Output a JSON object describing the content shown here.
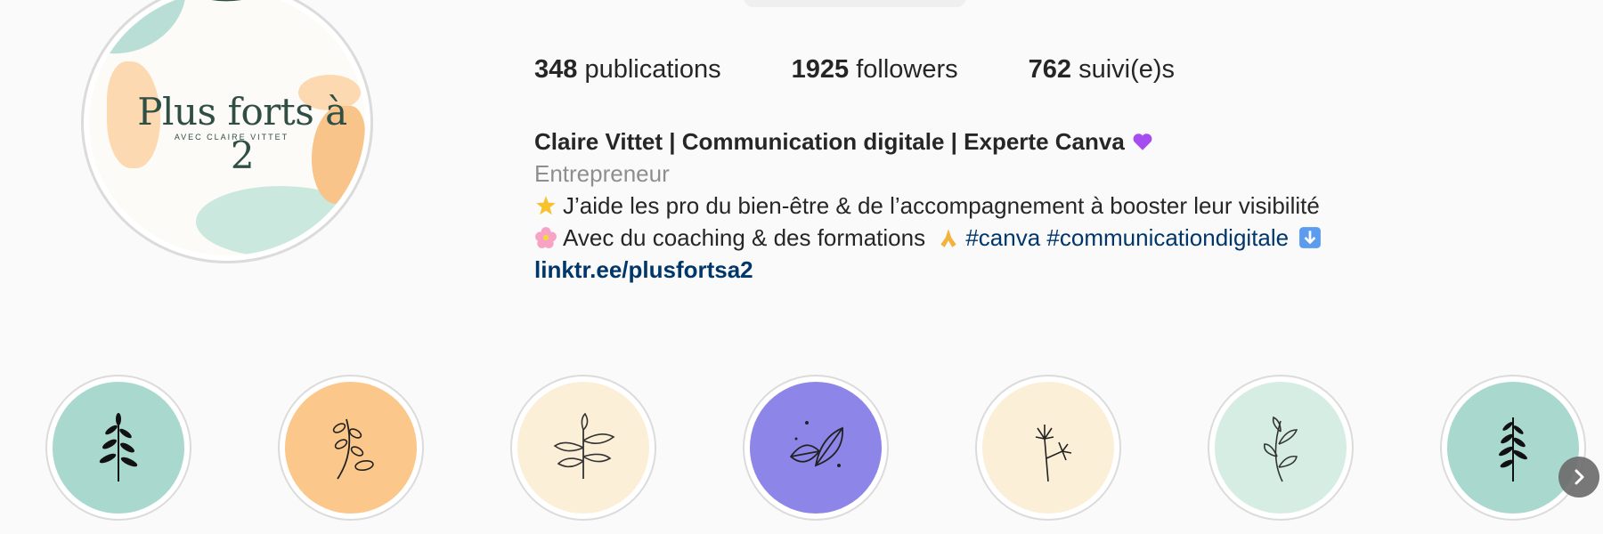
{
  "profile": {
    "avatar": {
      "logo_title": "Plus forts à 2",
      "logo_subtitle": "AVEC CLAIRE VITTET"
    },
    "stats": {
      "posts_count": "348",
      "posts_label": "publications",
      "followers_count": "1925",
      "followers_label": "followers",
      "following_count": "762",
      "following_label": "suivi(e)s"
    },
    "bio": {
      "name": "Claire Vittet | Communication digitale | Experte Canva",
      "name_emoji": "purple-heart-icon",
      "category": "Entrepreneur",
      "line1_text": "J’aide les pro du bien-être & de l’accompagnement à booster leur visibilité",
      "line1_emoji": "glowing-star-icon",
      "line2_text": "Avec du coaching & des formations",
      "line2_emoji_start": "cherry-blossom-icon",
      "line2_emoji_end": "folded-hands-icon",
      "hashtag1": "#canva",
      "hashtag2": "#communicationdigitale",
      "line2_arrow": "down-arrow-icon",
      "link": "linktr.ee/plusfortsa2"
    }
  },
  "highlights": [
    {
      "icon": "leaf-sprig-icon",
      "color": "#a9d8cf"
    },
    {
      "icon": "leaf-branch-icon",
      "color": "#fbc78a"
    },
    {
      "icon": "olive-leaves-icon",
      "color": "#fcefd8"
    },
    {
      "icon": "two-leaves-icon",
      "color": "#8d86e8"
    },
    {
      "icon": "dandelion-icon",
      "color": "#fcefd8"
    },
    {
      "icon": "curly-branch-icon",
      "color": "#d6ede4"
    },
    {
      "icon": "fern-sprig-icon",
      "color": "#a9d8cf"
    }
  ],
  "navigation": {
    "next_icon": "chevron-right-icon"
  }
}
